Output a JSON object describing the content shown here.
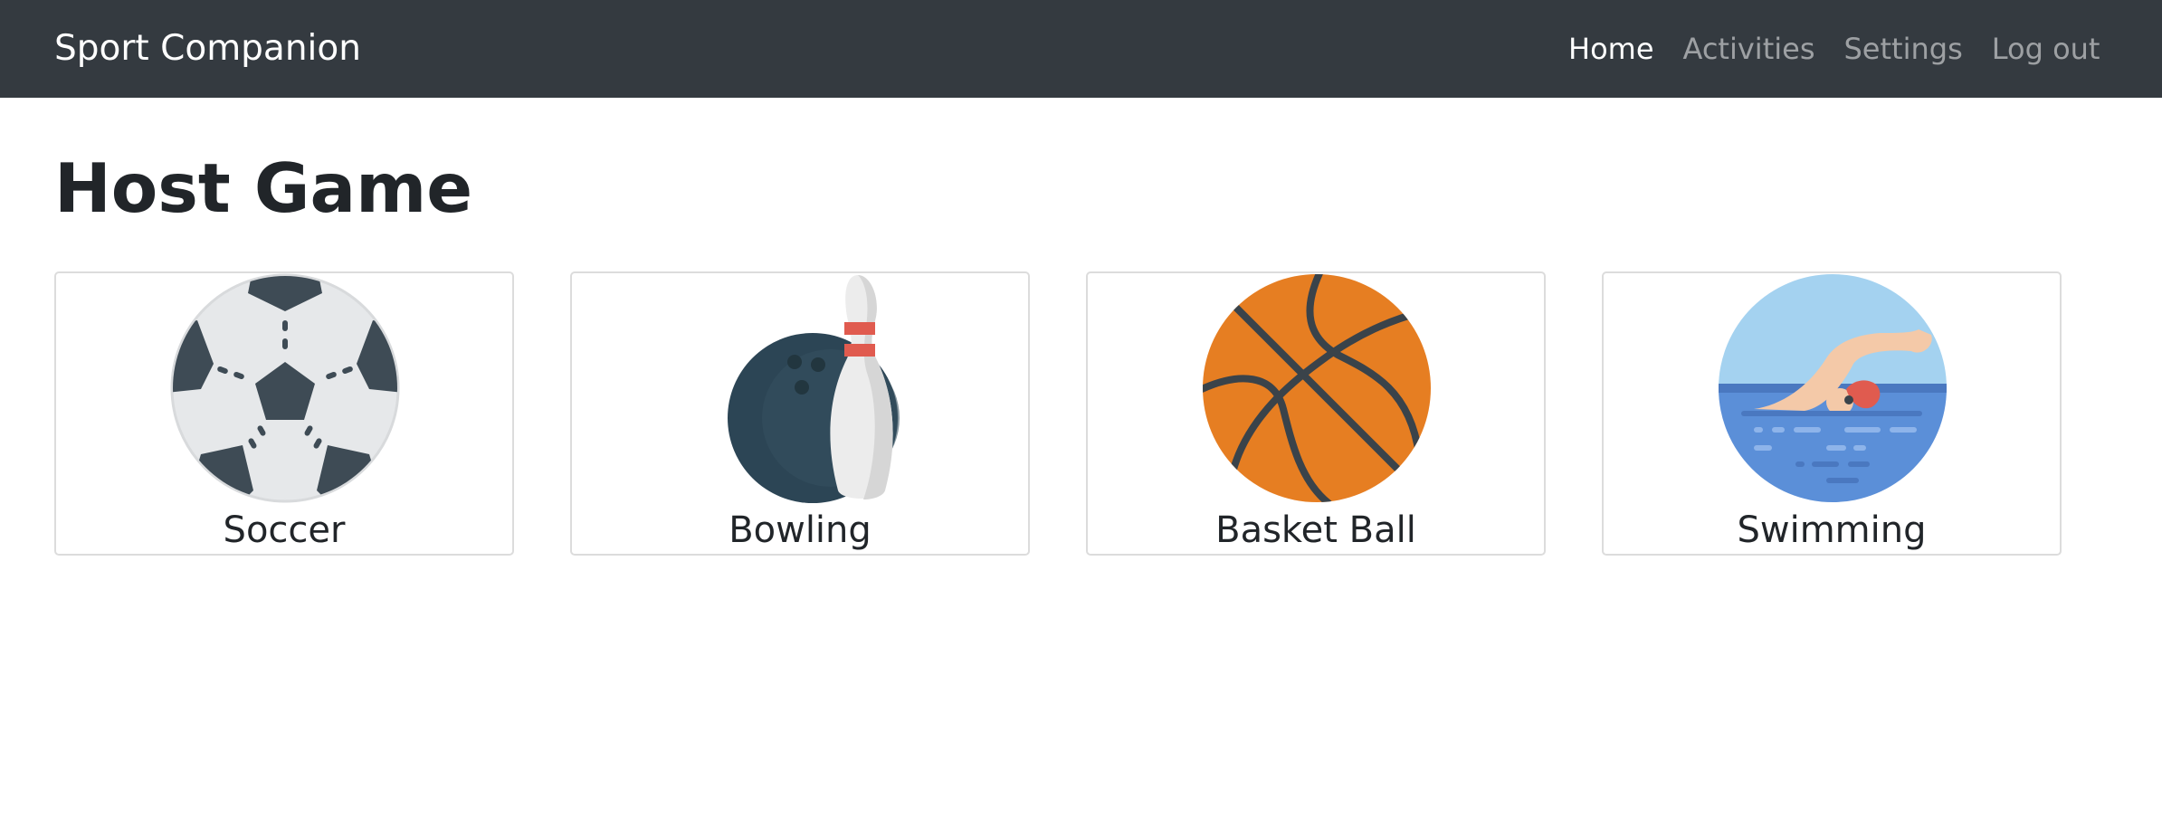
{
  "navbar": {
    "brand": "Sport Companion",
    "links": [
      {
        "label": "Home",
        "active": true
      },
      {
        "label": "Activities",
        "active": false
      },
      {
        "label": "Settings",
        "active": false
      },
      {
        "label": "Log out",
        "active": false
      }
    ]
  },
  "main": {
    "title": "Host Game",
    "cards": [
      {
        "label": "Soccer",
        "icon": "soccer-ball-icon"
      },
      {
        "label": "Bowling",
        "icon": "bowling-icon"
      },
      {
        "label": "Basket Ball",
        "icon": "basketball-icon"
      },
      {
        "label": "Swimming",
        "icon": "swimmer-icon"
      }
    ]
  },
  "colors": {
    "navbar_bg": "#343a40",
    "nav_active": "#ffffff",
    "nav_inactive": "#9a9da0",
    "basketball": "#e67e22",
    "water": "#5b8fd8"
  }
}
